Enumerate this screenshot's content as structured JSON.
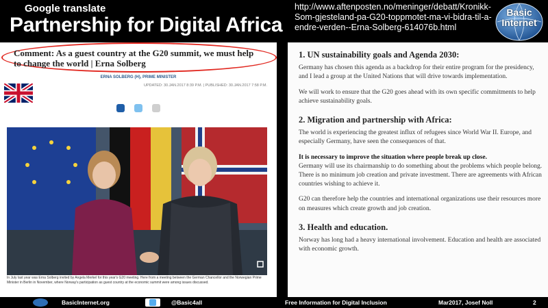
{
  "header": {
    "tool": "Google translate",
    "title": "Partnership for Digital Africa",
    "url": "http://www.aftenposten.no/meninger/debatt/Kronikk-Som-gjesteland-pa-G20-toppmotet-ma-vi-bidra-til-a-endre-verden--Erna-Solberg-614076b.html",
    "logo": "Basic Internet"
  },
  "article": {
    "headline": "Comment: As a guest country at the G20 summit, we must help to change the world | Erna Solberg",
    "author": "ERNA SOLBERG (H), PRIME MINISTER",
    "updated": "UPDATED: 30.JAN.2017 8:39 P.M. | PUBLISHED: 30.JAN.2017 7:58 P.M.",
    "caption": "In July last year was Erna Solberg invited by Angela Merkel for this year's G20 meeting. Here from a meeting between the German Chancellor and the Norwegian Prime Minister in Berlin in November, where Norway's participation as guest country at the economic summit were among issues discussed."
  },
  "content": {
    "s1_title": "1. UN sustainability goals and Agenda 2030:",
    "s1_p1": "Germany has chosen this agenda as a backdrop for their entire program for the presidency, and I lead a group at the United Nations that will drive towards implementation.",
    "s1_p2": "We will work to ensure that the G20 goes ahead with its own specific commitments to help achieve sustainability goals.",
    "s2_title": "2. Migration and partnership with Africa:",
    "s2_p1": "The world is experiencing the greatest influx of refugees since World War II. Europe, and especially Germany, have seen the consequences of that.",
    "s2_p2_bold": "It is necessary to improve the situation where people break up close.",
    "s2_p2": "Germany will use its chairmanship to do something about the problems which people belong. There is no minimum job creation and private investment. There are agreements with African countries wishing to achieve it.",
    "s2_p3": "G20 can therefore help the countries and international organizations use their resources more on measures which create growth and job creation.",
    "s3_title": "3. Health and education.",
    "s3_p1": "Norway has long had a heavy international involvement. Education and health are associated with economic growth."
  },
  "footer": {
    "site": "BasicInternet.org",
    "handle": "@Basic4all",
    "tagline": "Free Information for Digital Inclusion",
    "date_author": "Mar2017, Josef Noll",
    "page": "2"
  },
  "icons": {
    "flag": "uk-flag-icon",
    "share1": "facebook-icon",
    "share2": "twitter-icon",
    "share3": "email-icon",
    "expand": "expand-icon",
    "web": "globe-icon",
    "tw": "twitter-icon"
  },
  "colors": {
    "oval": "#e1271f",
    "author": "#2b5a8c",
    "logo": "#2e6eb5"
  }
}
